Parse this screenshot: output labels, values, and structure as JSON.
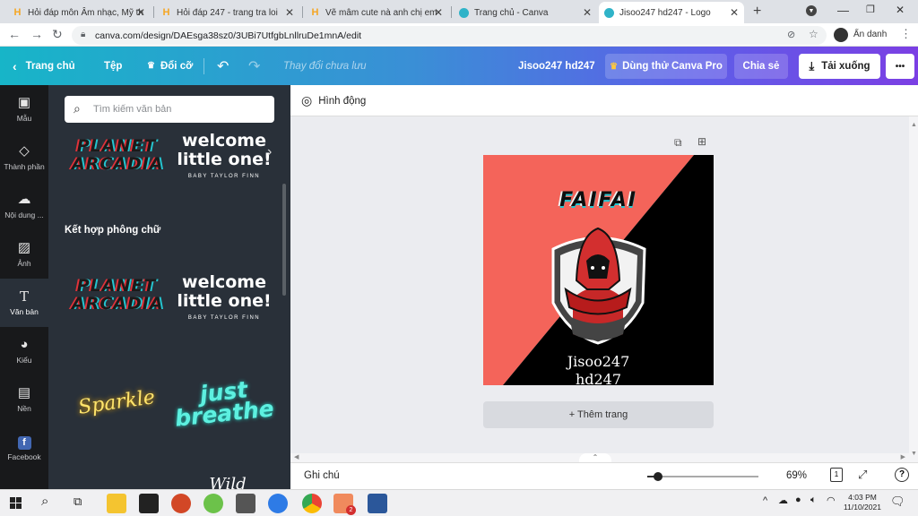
{
  "browser": {
    "tabs": [
      {
        "title": "Hỏi đáp môn Âm nhạc, Mỹ th",
        "icon": "hoidap-h-icon"
      },
      {
        "title": "Hỏi đáp 247 - trang tra loi",
        "icon": "hoidap-h-icon"
      },
      {
        "title": "Vẽ mâm cute nà anh chị em",
        "icon": "hoidap-h-icon"
      },
      {
        "title": "Trang chủ - Canva",
        "icon": "canva-icon"
      },
      {
        "title": "Jisoo247 hd247 - Logo",
        "icon": "canva-icon"
      }
    ],
    "url": "canva.com/design/DAEsga38sz0/3UBi7UtfgbLnllruDe1mnA/edit",
    "profile_label": "Ẩn danh"
  },
  "editor": {
    "home": "Trang chủ",
    "file": "Tệp",
    "resize": "Đổi cỡ",
    "status": "Thay đổi chưa lưu",
    "design_title": "Jisoo247 hd247",
    "try_pro": "Dùng thử Canva Pro",
    "share": "Chia sẻ",
    "download": "Tải xuống",
    "more": "•••"
  },
  "rail": [
    {
      "label": "Mẫu",
      "icon": "template-icon"
    },
    {
      "label": "Thành phần",
      "icon": "elements-icon"
    },
    {
      "label": "Nội dung ...",
      "icon": "upload-icon"
    },
    {
      "label": "Ảnh",
      "icon": "photo-icon"
    },
    {
      "label": "Văn bản",
      "icon": "text-icon"
    },
    {
      "label": "Kiểu",
      "icon": "palette-icon"
    },
    {
      "label": "Nền",
      "icon": "background-icon"
    },
    {
      "label": "Facebook",
      "icon": "facebook-icon"
    }
  ],
  "panel": {
    "search_placeholder": "Tìm kiếm văn bản",
    "section_title": "Kết hợp phông chữ",
    "samples": {
      "planet": "PLANET ARCADIA",
      "welcome_line1": "welcome",
      "welcome_line2": "little one!",
      "welcome_sub": "BABY TAYLOR FINN",
      "sparkle": "Sparkle",
      "just": "just",
      "breathe": "breathe",
      "partial": "Wild"
    }
  },
  "animate": {
    "label": "Hình động"
  },
  "design": {
    "headline": "FAIFAI",
    "name_line1": "Jisoo247",
    "name_line2": "hd247",
    "colors": {
      "left": "#f4645a",
      "right": "#000000"
    }
  },
  "add_page": "+ Thêm trang",
  "footer": {
    "notes": "Ghi chú",
    "zoom": "69%",
    "zoom_fraction": 0.1,
    "page_number": "1"
  },
  "taskbar": {
    "time": "4:03 PM",
    "date": "11/10/2021",
    "badge": "2"
  }
}
